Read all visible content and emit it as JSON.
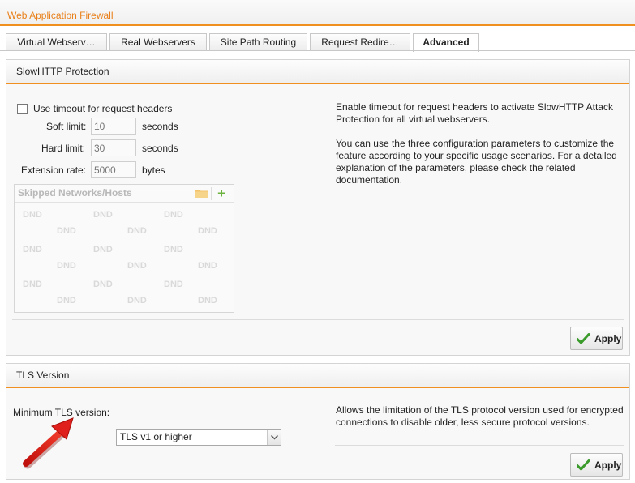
{
  "header": {
    "title": "Web Application Firewall"
  },
  "tabs": [
    {
      "label": "Virtual Webserv…"
    },
    {
      "label": "Real Webservers"
    },
    {
      "label": "Site Path Routing"
    },
    {
      "label": "Request Redire…"
    },
    {
      "label": "Advanced"
    }
  ],
  "active_tab": "Advanced",
  "slowhttp": {
    "title": "SlowHTTP Protection",
    "checkbox_label": "Use timeout for request headers",
    "checkbox_checked": false,
    "soft_limit": {
      "label": "Soft limit:",
      "placeholder": "10",
      "unit": "seconds"
    },
    "hard_limit": {
      "label": "Hard limit:",
      "placeholder": "30",
      "unit": "seconds"
    },
    "extension_rate": {
      "label": "Extension rate:",
      "placeholder": "5000",
      "unit": "bytes"
    },
    "skipped_networks": {
      "title": "Skipped Networks/Hosts",
      "placeholder_text": "DND",
      "add_icon": "plus-icon",
      "folder_icon": "folder-icon"
    },
    "description_1": "Enable timeout for request headers to activate SlowHTTP Attack Protection for all virtual webservers.",
    "description_2": "You can use the three configuration parameters to customize the feature according to your specific usage scenarios. For a detailed explanation of the parameters, please check the related documentation.",
    "apply_label": "Apply"
  },
  "tls": {
    "title": "TLS Version",
    "min_label": "Minimum TLS version:",
    "selected": "TLS v1 or higher",
    "description": "Allows the limitation of the TLS protocol version used for encrypted connections to disable older, less secure protocol versions.",
    "apply_label": "Apply"
  },
  "colors": {
    "accent": "#f0901e",
    "title": "#e9801a",
    "apply_check": "#3a9a2a",
    "annotation_arrow": "#e0201c"
  }
}
